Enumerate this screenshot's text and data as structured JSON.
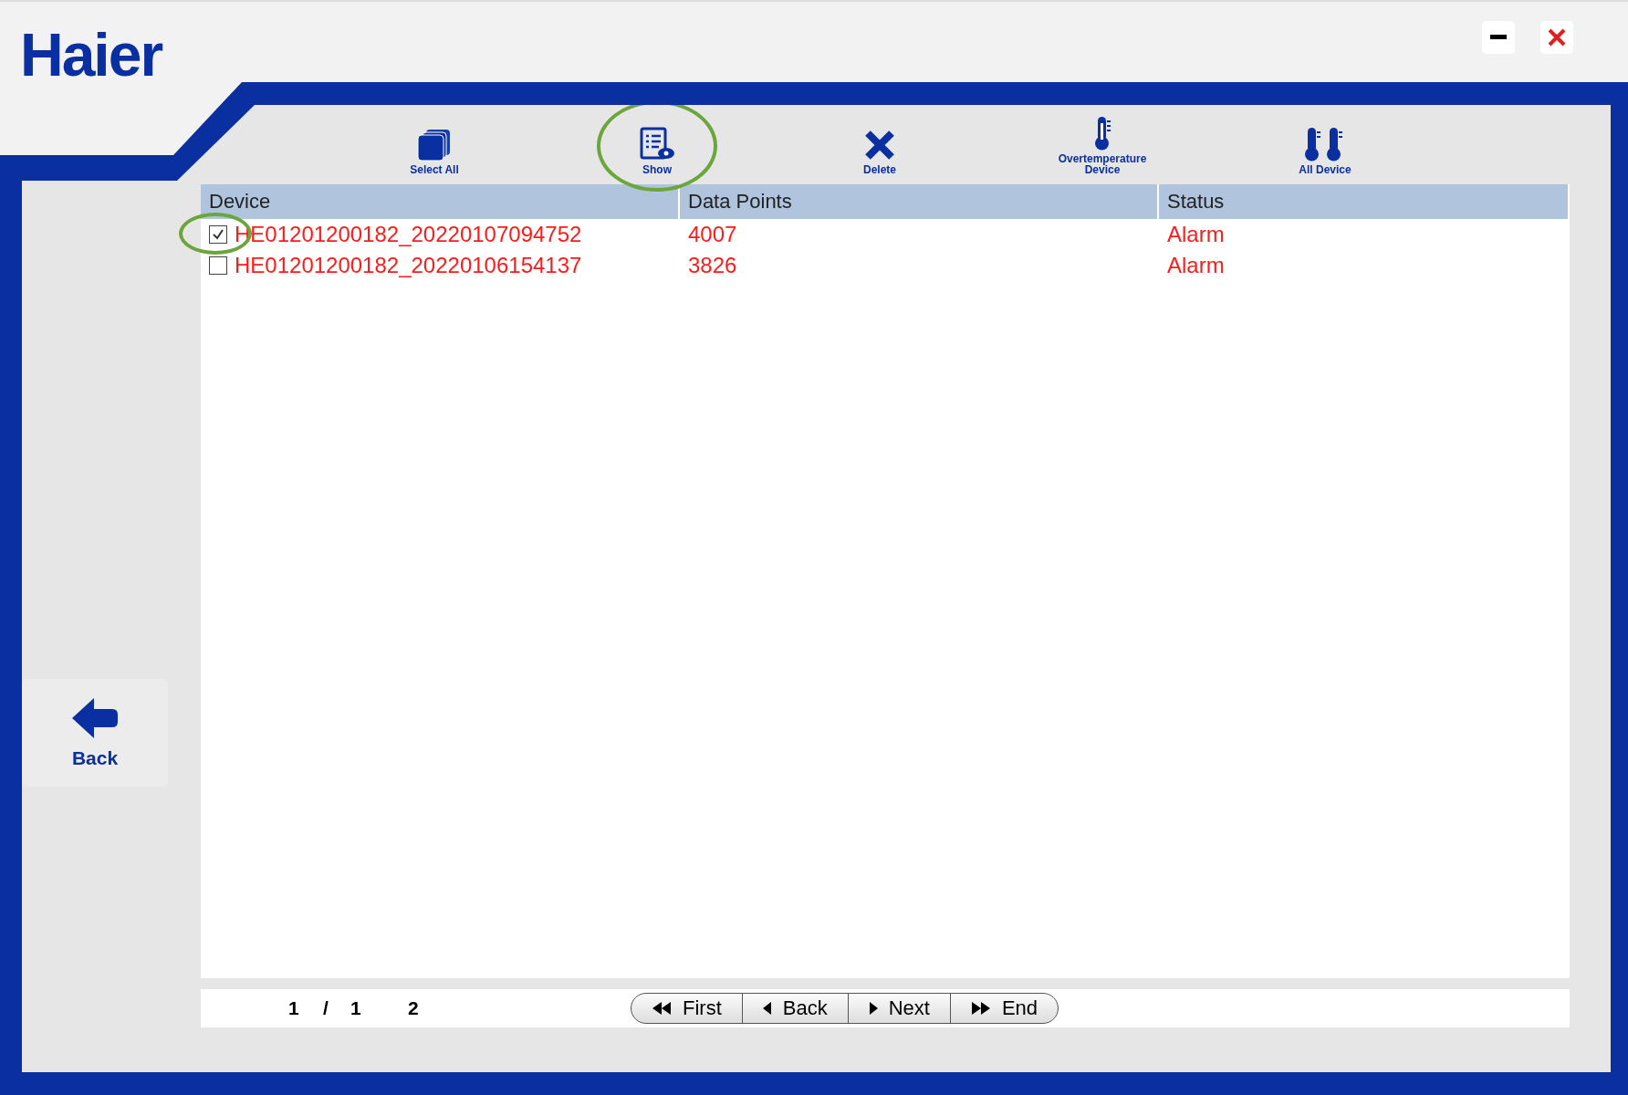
{
  "app": {
    "logo": "Haier"
  },
  "window_controls": [
    {
      "kind": "minimize"
    },
    {
      "kind": "close"
    }
  ],
  "toolbar": [
    {
      "kind": "select_all",
      "label": "Select All",
      "highlighted": false
    },
    {
      "kind": "show",
      "label": "Show",
      "highlighted": true
    },
    {
      "kind": "delete",
      "label": "Delete",
      "highlighted": false
    },
    {
      "kind": "overtemp",
      "label": "Overtemperature Device",
      "highlighted": false
    },
    {
      "kind": "all",
      "label": "All Device",
      "highlighted": false
    }
  ],
  "back": {
    "label": "Back"
  },
  "table": {
    "columns": [
      "Device",
      "Data Points",
      "Status"
    ],
    "rows": [
      {
        "checked": true,
        "highlighted": true,
        "device": "HE01201200182_20220107094752",
        "data_points": "4007",
        "status": "Alarm"
      },
      {
        "checked": false,
        "device": "HE01201200182_20220106154137",
        "data_points": "3826",
        "status": "Alarm"
      }
    ]
  },
  "pager": {
    "current": "1",
    "separator": "/",
    "total": "1",
    "count": "2",
    "buttons": [
      {
        "kind": "first",
        "label": "First"
      },
      {
        "kind": "back",
        "label": "Back"
      },
      {
        "kind": "next",
        "label": "Next"
      },
      {
        "kind": "end",
        "label": "End"
      }
    ]
  }
}
